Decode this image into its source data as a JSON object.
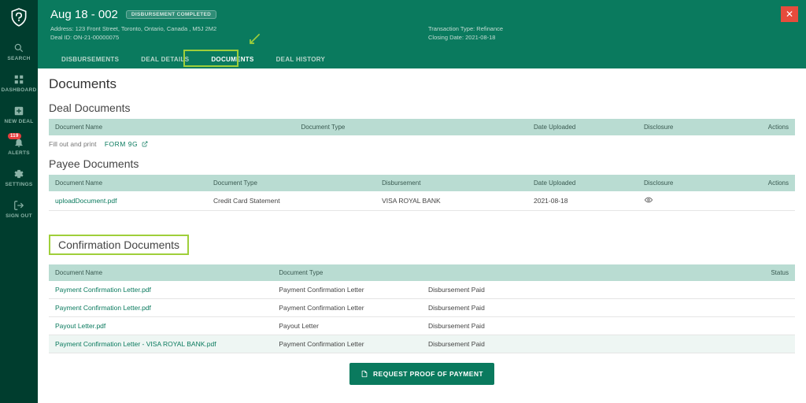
{
  "sidebar": {
    "items": [
      {
        "label": "SEARCH"
      },
      {
        "label": "DASHBOARD"
      },
      {
        "label": "NEW DEAL"
      },
      {
        "label": "ALERTS",
        "badge": "119"
      },
      {
        "label": "SETTINGS"
      },
      {
        "label": "SIGN OUT"
      }
    ]
  },
  "header": {
    "title": "Aug 18 - 002",
    "status_chip": "DISBURSEMENT COMPLETED",
    "address": "Address: 123 Front Street, Toronto, Ontario, Canada , M5J 2M2",
    "deal_id": "Deal ID: ON-21-00000075",
    "txn_type": "Transaction Type: Refinance",
    "closing": "Closing Date: 2021-08-18",
    "tabs": [
      "DISBURSEMENTS",
      "DEAL DETAILS",
      "DOCUMENTS",
      "DEAL HISTORY"
    ],
    "close": "✕"
  },
  "page": {
    "title": "Documents",
    "helper_text": "Fill out and print",
    "form_link": "FORM 9G"
  },
  "deal_docs": {
    "title": "Deal Documents",
    "headers": [
      "Document Name",
      "Document Type",
      "Date Uploaded",
      "Disclosure",
      "Actions"
    ]
  },
  "payee_docs": {
    "title": "Payee Documents",
    "headers": [
      "Document Name",
      "Document Type",
      "Disbursement",
      "Date Uploaded",
      "Disclosure",
      "Actions"
    ],
    "rows": [
      {
        "name": "uploadDocument.pdf",
        "type": "Credit Card Statement",
        "disb": "VISA ROYAL BANK",
        "date": "2021-08-18"
      }
    ]
  },
  "conf_docs": {
    "title": "Confirmation Documents",
    "headers": [
      "Document Name",
      "Document Type",
      "Status"
    ],
    "rows": [
      {
        "name": "Payment Confirmation Letter.pdf",
        "type": "Payment Confirmation Letter",
        "status": "Disbursement Paid"
      },
      {
        "name": "Payment Confirmation Letter.pdf",
        "type": "Payment Confirmation Letter",
        "status": "Disbursement Paid"
      },
      {
        "name": "Payout Letter.pdf",
        "type": "Payout Letter",
        "status": "Disbursement Paid"
      },
      {
        "name": "Payment Confirmation Letter - VISA ROYAL BANK.pdf",
        "type": "Payment Confirmation Letter",
        "status": "Disbursement Paid"
      }
    ]
  },
  "request_btn": "REQUEST PROOF OF PAYMENT"
}
